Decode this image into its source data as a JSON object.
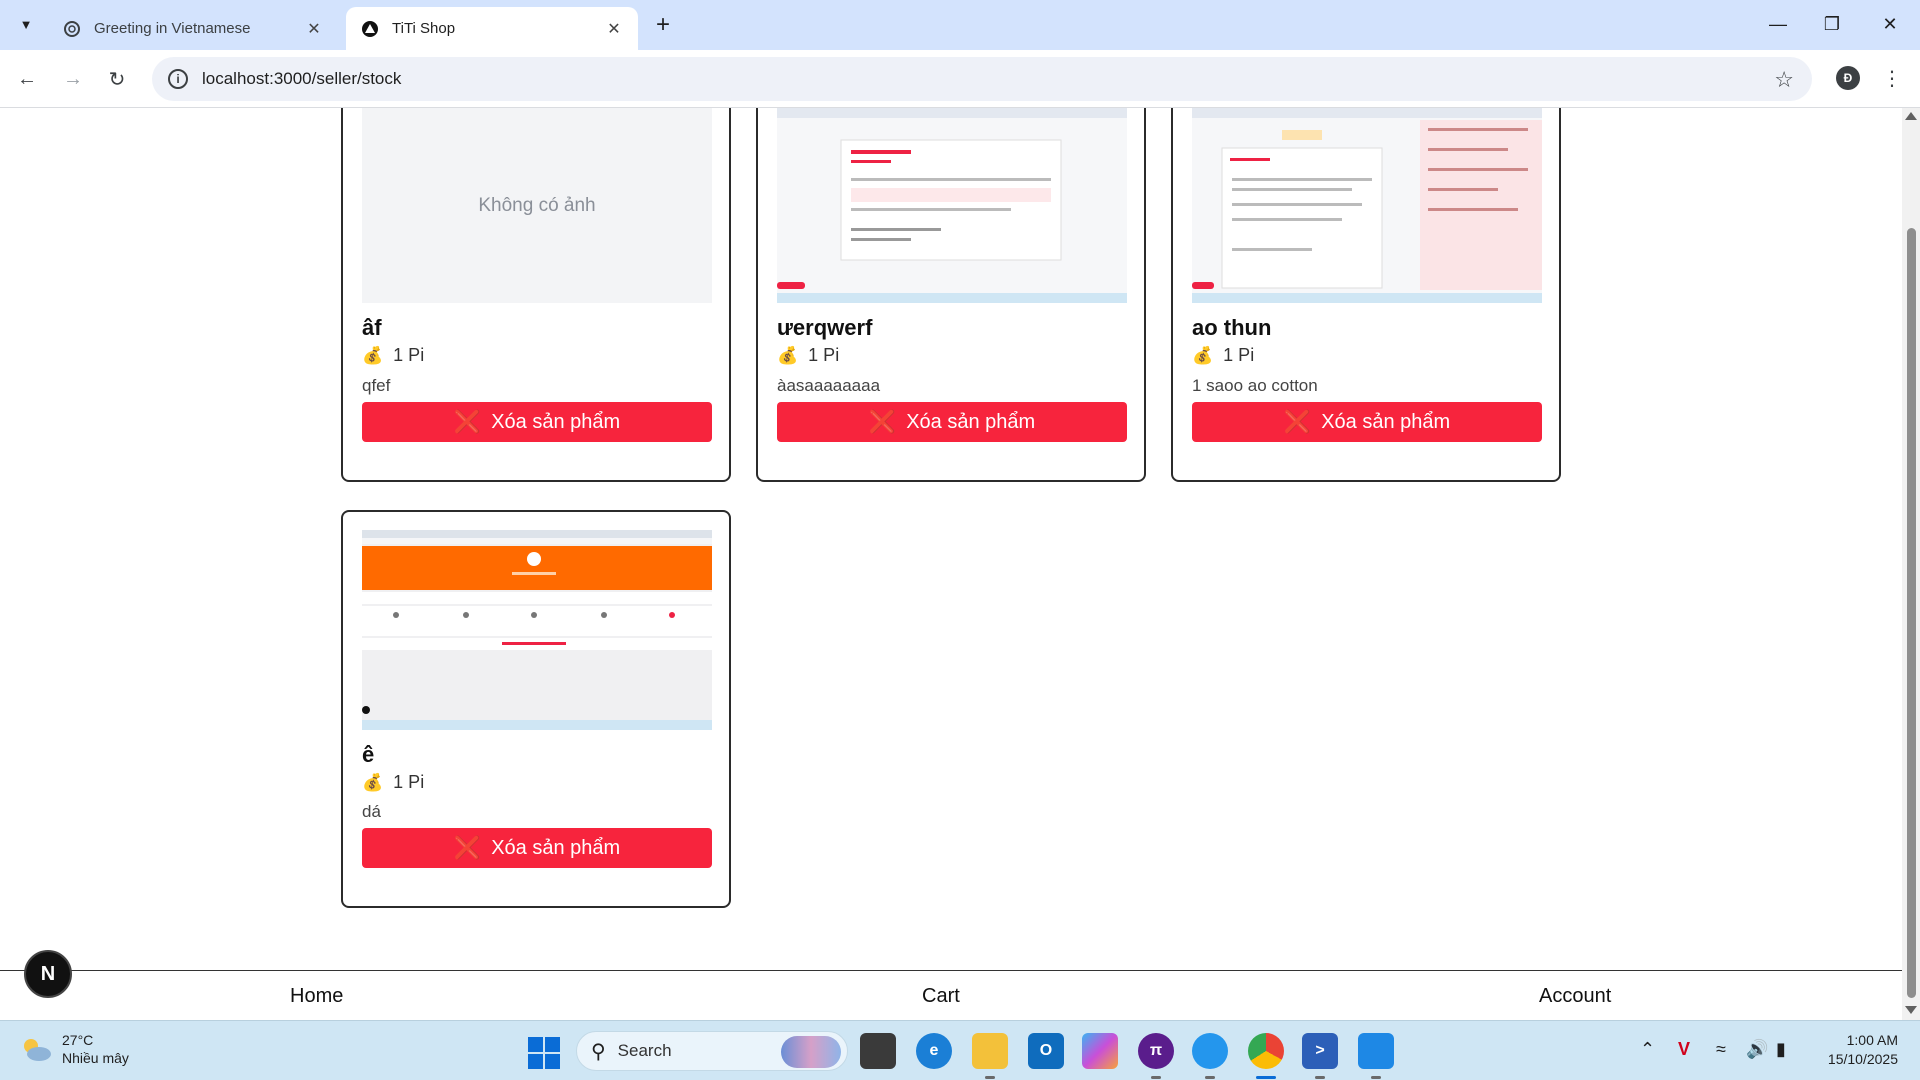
{
  "browser": {
    "tabs": [
      {
        "title": "Greeting in Vietnamese",
        "icon": "chatgpt-icon",
        "active": false
      },
      {
        "title": "TiTi Shop",
        "icon": "nextjs-icon",
        "active": true
      }
    ],
    "url": "localhost:3000/seller/stock",
    "profile_initial": "Đ"
  },
  "products": [
    {
      "name": "âf",
      "price": "1 Pi",
      "description": "qfef",
      "image": "none",
      "no_image_text": "Không có ảnh",
      "delete_label": "Xóa sản phẩm"
    },
    {
      "name": "ưerqwerf",
      "price": "1 Pi",
      "description": "àasaaaaaaaa",
      "image": "screenshot",
      "delete_label": "Xóa sản phẩm"
    },
    {
      "name": "ao thun",
      "price": "1 Pi",
      "description": "1 saoo ao cotton",
      "image": "screenshot",
      "delete_label": "Xóa sản phẩm"
    },
    {
      "name": "ê",
      "price": "1 Pi",
      "description": "dá",
      "image": "screenshot",
      "delete_label": "Xóa sản phẩm"
    }
  ],
  "bottom_nav": {
    "home": "Home",
    "cart": "Cart",
    "account": "Account"
  },
  "next_badge": "N",
  "taskbar": {
    "weather_temp": "27°C",
    "weather_desc": "Nhiều mây",
    "search_label": "Search",
    "time": "1:00 AM",
    "date": "15/10/2025"
  },
  "colors": {
    "accent_delete": "#f7243d",
    "tabbar": "#d3e3fd",
    "taskbar": "#cfe6f4"
  }
}
